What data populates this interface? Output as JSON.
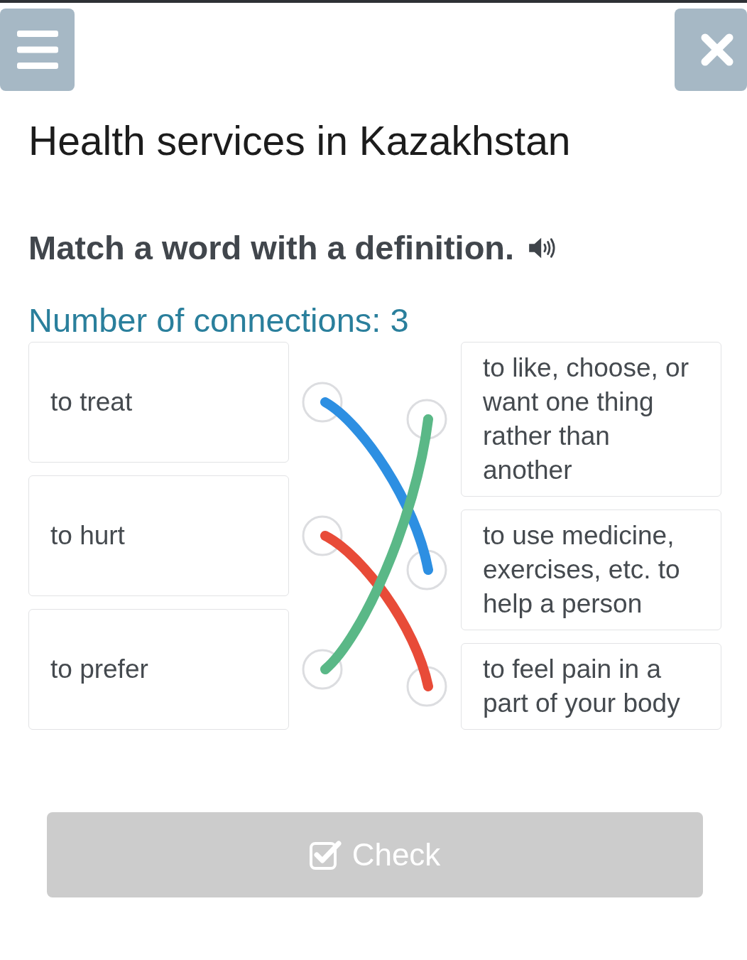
{
  "title": "Health services in Kazakhstan",
  "instruction": {
    "text": "Match a word with a definition."
  },
  "connections_label": "Number of connections: 3",
  "words": [
    {
      "text": "to treat",
      "color": "#2d8fe2"
    },
    {
      "text": "to hurt",
      "color": "#e84b38"
    },
    {
      "text": "to prefer",
      "color": "#5ab887"
    }
  ],
  "definitions": [
    {
      "text": "to like, choose, or want one thing rather than another",
      "color": "#5ab887"
    },
    {
      "text": "to use medicine, exercises, etc. to help a person",
      "color": "#2d8fe2"
    },
    {
      "text": "to feel pain in a part of your body",
      "color": "#e84b38"
    }
  ],
  "check_button": {
    "label": "Check",
    "disabled": true
  }
}
